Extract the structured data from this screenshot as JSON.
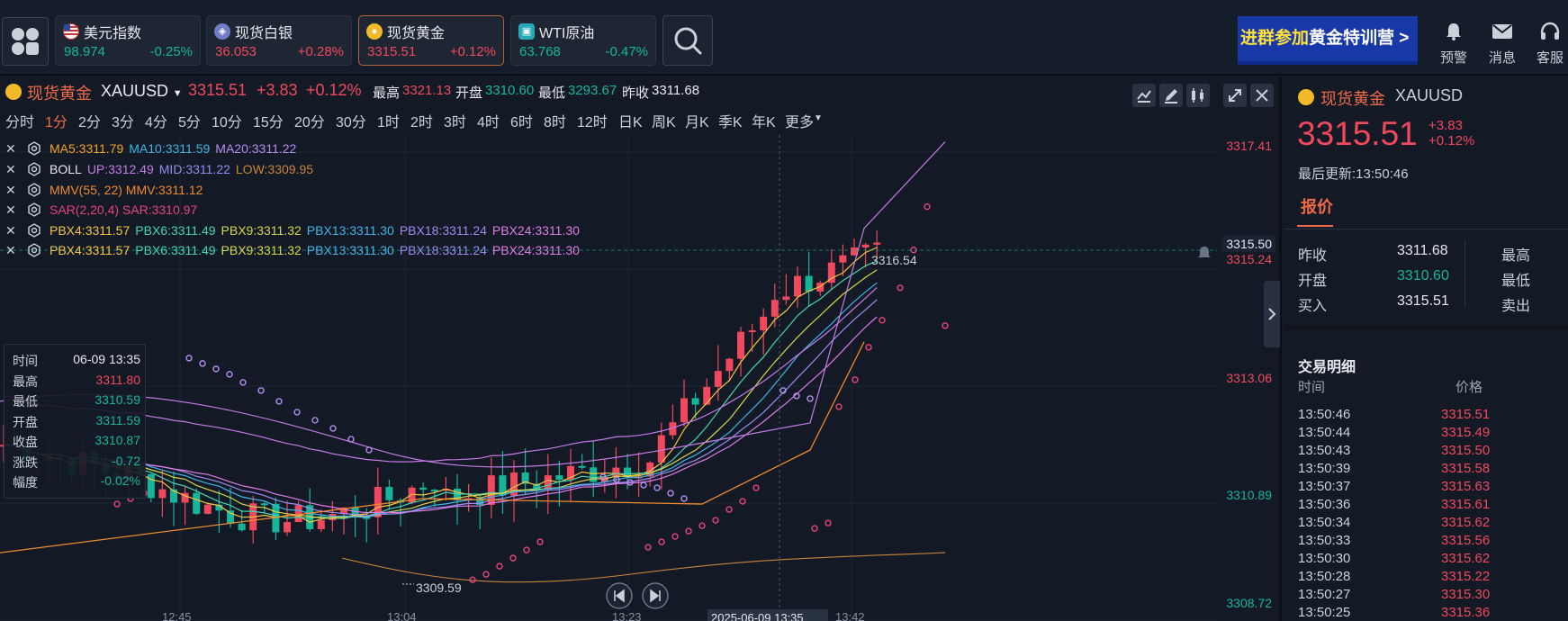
{
  "topbar": {
    "tickers": [
      {
        "name": "美元指数",
        "price": "98.974",
        "change": "-0.25%",
        "direction": "down",
        "icon": "us-flag-icon"
      },
      {
        "name": "现货白银",
        "price": "36.053",
        "change": "+0.28%",
        "direction": "up",
        "icon": "silver-coin-icon"
      },
      {
        "name": "现货黄金",
        "price": "3315.51",
        "change": "+0.12%",
        "direction": "up",
        "icon": "gold-coin-icon",
        "active": true
      },
      {
        "name": "WTI原油",
        "price": "63.768",
        "change": "-0.47%",
        "direction": "down",
        "icon": "oil-icon"
      }
    ],
    "promo": {
      "part1": "进群参加",
      "part2": "黄金特训营 >"
    },
    "tools": [
      {
        "label": "预警",
        "icon": "bell-icon"
      },
      {
        "label": "消息",
        "icon": "mail-icon"
      },
      {
        "label": "客服",
        "icon": "headset-icon"
      }
    ]
  },
  "symbol": {
    "name": "现货黄金",
    "code": "XAUUSD",
    "price": "3315.51",
    "change": "+3.83",
    "change_pct": "+0.12%",
    "high_label": "最高",
    "high": "3321.13",
    "open_label": "开盘",
    "open": "3310.60",
    "low_label": "最低",
    "low": "3293.67",
    "prev_label": "昨收",
    "prev": "3311.68"
  },
  "intervals": [
    "分时",
    "1分",
    "2分",
    "3分",
    "4分",
    "5分",
    "10分",
    "15分",
    "20分",
    "30分",
    "1时",
    "2时",
    "3时",
    "4时",
    "6时",
    "8时",
    "12时",
    "日K",
    "周K",
    "月K",
    "季K",
    "年K",
    "更多"
  ],
  "active_interval": "1分",
  "indicators": {
    "ma": [
      {
        "text": "MA5:3311.79",
        "color": "#f5a623"
      },
      {
        "text": "MA10:3311.59",
        "color": "#3fb5e8"
      },
      {
        "text": "MA20:3311.22",
        "color": "#b58cf0"
      }
    ],
    "boll": [
      {
        "text": "BOLL",
        "color": "#e6e9ef"
      },
      {
        "text": "UP:3312.49",
        "color": "#c67ae6"
      },
      {
        "text": "MID:3311.22",
        "color": "#8f8ff0"
      },
      {
        "text": "LOW:3309.95",
        "color": "#c9843a"
      }
    ],
    "mmv": [
      {
        "text": "MMV(55, 22) MMV:3311.12",
        "color": "#f08a2e"
      }
    ],
    "sar": [
      {
        "text": "SAR(2,20,4) SAR:3310.97",
        "color": "#e8447a"
      }
    ],
    "pbx": [
      {
        "text": "PBX4:3311.57",
        "color": "#f5c542"
      },
      {
        "text": "PBX6:3311.49",
        "color": "#44d6b0"
      },
      {
        "text": "PBX9:3311.32",
        "color": "#d6d64a"
      },
      {
        "text": "PBX13:3311.30",
        "color": "#3fb5e8"
      },
      {
        "text": "PBX18:3311.24",
        "color": "#9a8cf0"
      },
      {
        "text": "PBX24:3311.30",
        "color": "#e07ae6"
      }
    ]
  },
  "ohlc_box": [
    {
      "label": "时间",
      "value": "06-09 13:35",
      "color": "#e6e9ef"
    },
    {
      "label": "最高",
      "value": "3311.80",
      "color": "#f0485c"
    },
    {
      "label": "最低",
      "value": "3310.59",
      "color": "#16b59a"
    },
    {
      "label": "开盘",
      "value": "3311.59",
      "color": "#16b59a"
    },
    {
      "label": "收盘",
      "value": "3310.87",
      "color": "#16b59a"
    },
    {
      "label": "涨跌",
      "value": "-0.72",
      "color": "#16b59a"
    },
    {
      "label": "幅度",
      "value": "-0.02%",
      "color": "#16b59a"
    }
  ],
  "axis": {
    "y_labels": [
      "3317.41",
      "3315.24",
      "3313.06",
      "3310.89",
      "3308.72"
    ],
    "current_label": "3315.50",
    "x_labels": [
      "12:45",
      "13:04",
      "13:23",
      "13:42"
    ],
    "crosshair_label": "2025-06-09 13:35",
    "min_label": "3309.59",
    "max_label": "3316.54"
  },
  "colors": {
    "up": "#f0485c",
    "down": "#16b59a",
    "accent": "#f06a48",
    "background": "#131a26"
  },
  "right_panel": {
    "name": "现货黄金",
    "code": "XAUUSD",
    "price": "3315.51",
    "change": "+3.83",
    "change_pct": "+0.12%",
    "updated": "最后更新:13:50:46",
    "tab": "报价",
    "quotes": [
      {
        "label": "昨收",
        "value": "3311.68",
        "color": "#e6e9ef",
        "label2": "最高"
      },
      {
        "label": "开盘",
        "value": "3310.60",
        "color": "#16b59a",
        "label2": "最低"
      },
      {
        "label": "买入",
        "value": "3315.51",
        "color": "#e6e9ef",
        "label2": "卖出"
      }
    ],
    "trades_title": "交易明细",
    "trades_header": {
      "time": "时间",
      "price": "价格"
    },
    "trades": [
      {
        "time": "13:50:46",
        "price": "3315.51"
      },
      {
        "time": "13:50:44",
        "price": "3315.49"
      },
      {
        "time": "13:50:43",
        "price": "3315.50"
      },
      {
        "time": "13:50:39",
        "price": "3315.58"
      },
      {
        "time": "13:50:37",
        "price": "3315.63"
      },
      {
        "time": "13:50:36",
        "price": "3315.61"
      },
      {
        "time": "13:50:34",
        "price": "3315.62"
      },
      {
        "time": "13:50:33",
        "price": "3315.56"
      },
      {
        "time": "13:50:30",
        "price": "3315.62"
      },
      {
        "time": "13:50:28",
        "price": "3315.22"
      },
      {
        "time": "13:50:27",
        "price": "3315.30"
      },
      {
        "time": "13:50:25",
        "price": "3315.36"
      }
    ]
  }
}
